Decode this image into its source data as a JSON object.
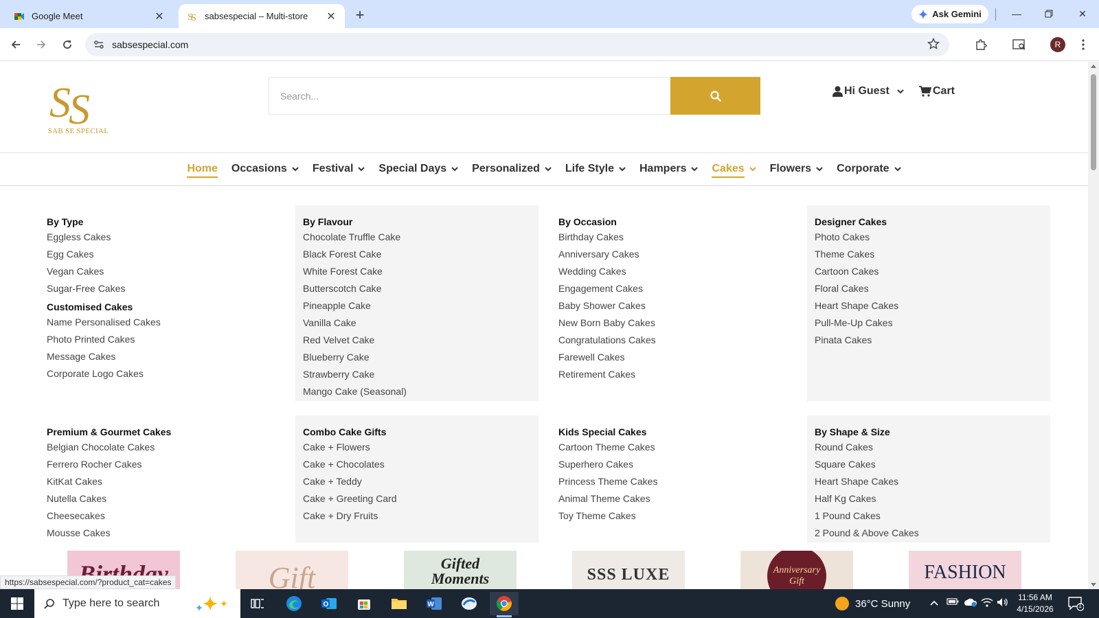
{
  "browser": {
    "tabs": [
      {
        "title": "Google Meet",
        "active": false
      },
      {
        "title": "sabsespecial – Multi-store",
        "active": true
      }
    ],
    "gemini_label": "Ask Gemini",
    "url": "sabsespecial.com",
    "profile_initial": "R",
    "status_url": "https://sabsespecial.com/?product_cat=cakes"
  },
  "site": {
    "logo_monogram": "SS",
    "logo_text": "SAB SE SPECIAL",
    "search_placeholder": "Search...",
    "account_label": "Hi Guest",
    "cart_label": "Cart",
    "brand_color": "#d4a52e"
  },
  "nav": {
    "items": [
      {
        "label": "Home",
        "dropdown": false
      },
      {
        "label": "Occasions",
        "dropdown": true
      },
      {
        "label": "Festival",
        "dropdown": true
      },
      {
        "label": "Special Days",
        "dropdown": true
      },
      {
        "label": "Personalized",
        "dropdown": true
      },
      {
        "label": "Life Style",
        "dropdown": true
      },
      {
        "label": "Hampers",
        "dropdown": true
      },
      {
        "label": "Cakes",
        "dropdown": true
      },
      {
        "label": "Flowers",
        "dropdown": true
      },
      {
        "label": "Corporate",
        "dropdown": true
      }
    ]
  },
  "mega_menu": {
    "row1": [
      {
        "title": "By Type",
        "links": [
          "Eggless Cakes",
          "Egg Cakes",
          "Vegan Cakes",
          "Sugar-Free Cakes"
        ],
        "sub_title": "Customised Cakes",
        "sub_links": [
          "Name Personalised Cakes",
          "Photo Printed Cakes",
          "Message Cakes",
          "Corporate Logo Cakes"
        ]
      },
      {
        "title": "By Flavour",
        "links": [
          "Chocolate Truffle Cake",
          "Black Forest Cake",
          "White Forest Cake",
          "Butterscotch Cake",
          "Pineapple Cake",
          "Vanilla Cake",
          "Red Velvet Cake",
          "Blueberry Cake",
          "Strawberry Cake",
          "Mango Cake (Seasonal)"
        ]
      },
      {
        "title": "By Occasion",
        "links": [
          "Birthday Cakes",
          "Anniversary Cakes",
          "Wedding Cakes",
          "Engagement Cakes",
          "Baby Shower Cakes",
          "New Born Baby Cakes",
          "Congratulations Cakes",
          "Farewell Cakes",
          "Retirement Cakes"
        ]
      },
      {
        "title": "Designer Cakes",
        "links": [
          "Photo Cakes",
          "Theme Cakes",
          "Cartoon Cakes",
          "Floral Cakes",
          "Heart Shape Cakes",
          "Pull-Me-Up Cakes",
          "Pinata Cakes"
        ]
      }
    ],
    "row2": [
      {
        "title": "Premium & Gourmet Cakes",
        "links": [
          "Belgian Chocolate Cakes",
          "Ferrero Rocher Cakes",
          "KitKat Cakes",
          "Nutella Cakes",
          "Cheesecakes",
          "Mousse Cakes"
        ]
      },
      {
        "title": "Combo Cake Gifts",
        "links": [
          "Cake + Flowers",
          "Cake + Chocolates",
          "Cake + Teddy",
          "Cake + Greeting Card",
          "Cake + Dry Fruits"
        ]
      },
      {
        "title": "Kids Special Cakes",
        "links": [
          "Cartoon Theme Cakes",
          "Superhero Cakes",
          "Princess Theme Cakes",
          "Animal Theme Cakes",
          "Toy Theme Cakes"
        ]
      },
      {
        "title": "By Shape & Size",
        "links": [
          "Round Cakes",
          "Square Cakes",
          "Heart Shape Cakes",
          "Half Kg Cakes",
          "1 Pound Cakes",
          "2 Pound & Above Cakes"
        ]
      }
    ]
  },
  "banners": [
    {
      "text": "Birthday",
      "bg": "#f3c6d6",
      "fg": "#6a1e3a"
    },
    {
      "text": "Gift",
      "bg": "#f6e7e3",
      "fg": "#c9a58a"
    },
    {
      "text": "Gifted Moments",
      "bg": "#dfe8df",
      "fg": "#222222"
    },
    {
      "text": "SSS LUXE",
      "bg": "#eeeae6",
      "fg": "#333333"
    },
    {
      "text": "Anniversary Gift",
      "bg": "#6b1e2a",
      "fg": "#f3d39a"
    },
    {
      "text": "FASHION",
      "bg": "#f3d6dc",
      "fg": "#1e2a4a"
    }
  ],
  "taskbar": {
    "search_placeholder": "Type here to search",
    "weather": "36°C  Sunny",
    "time": "11:56 AM",
    "date": "4/15/2026",
    "notification_count": "1"
  }
}
